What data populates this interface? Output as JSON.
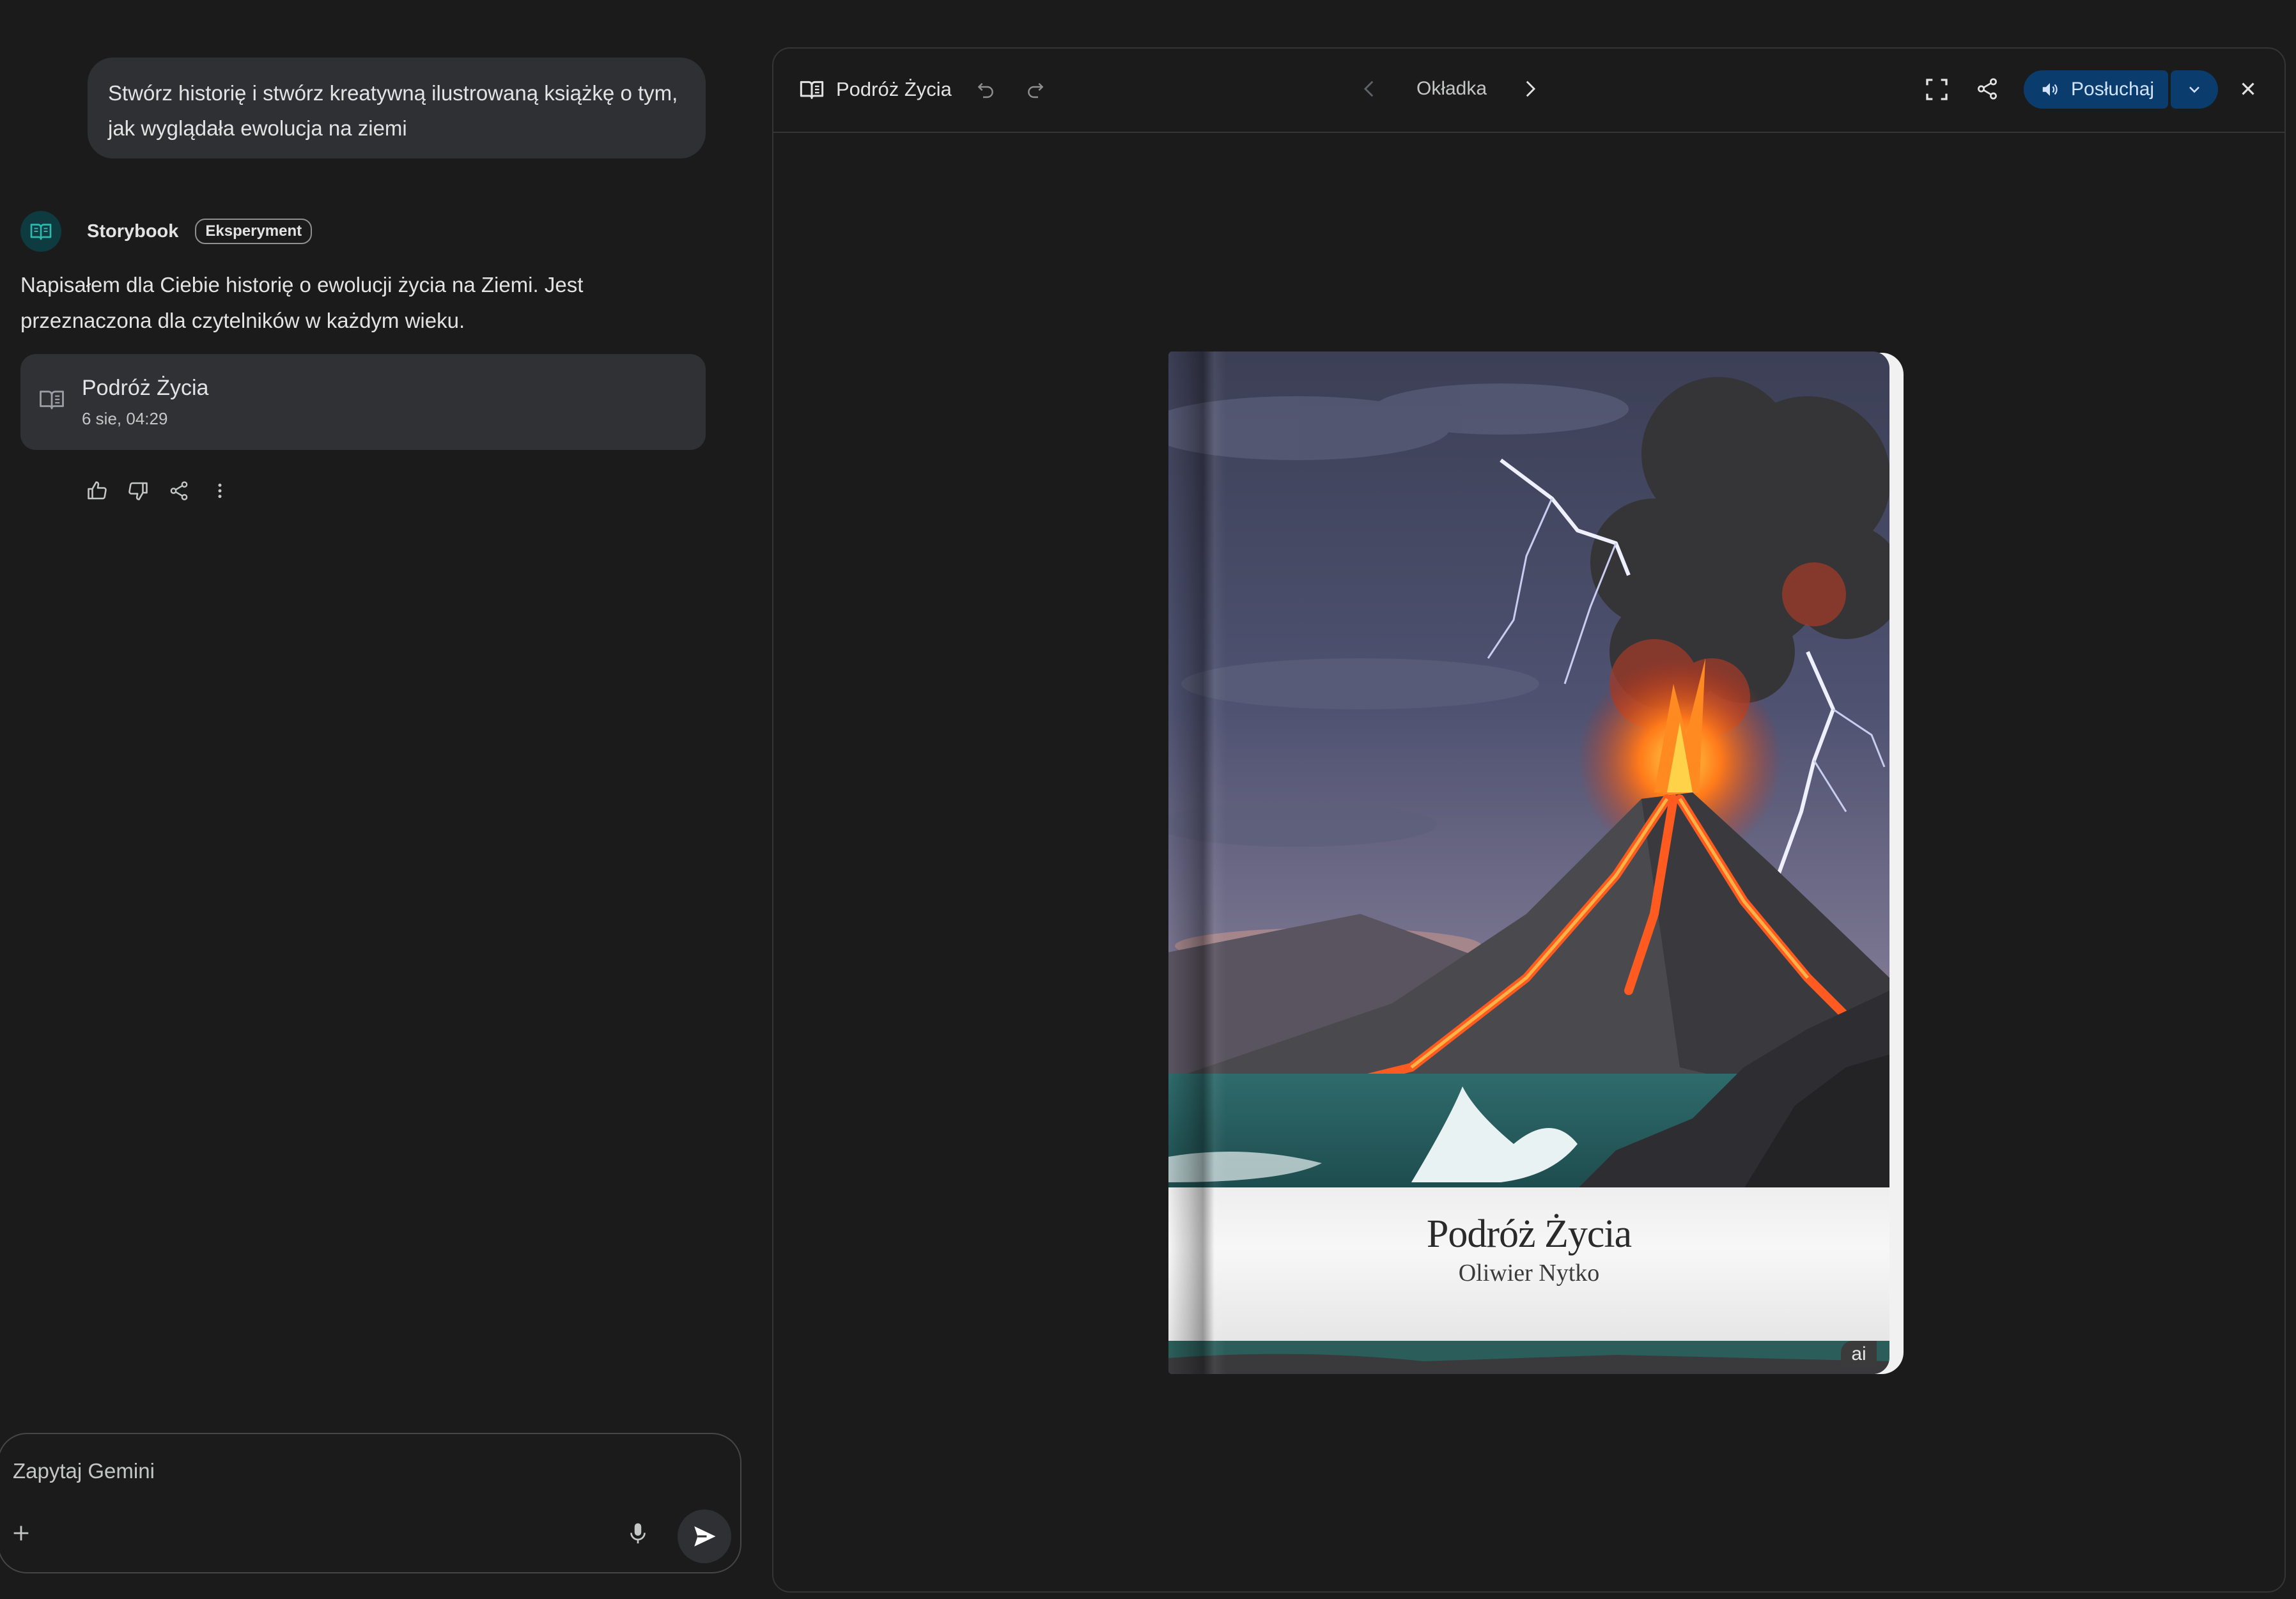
{
  "chat": {
    "user_message": "Stwórz historię i stwórz kreatywną ilustrowaną książkę o tym, jak wyglądała ewolucja na ziemi",
    "agent": {
      "name": "Storybook",
      "badge": "Eksperyment",
      "response": "Napisałem dla Ciebie historię o ewolucji życia na Ziemi. Jest przeznaczona dla czytelników w każdym wieku."
    },
    "story_card": {
      "title": "Podróż Życia",
      "date": "6 sie, 04:29",
      "icon": "book-icon"
    },
    "feedback_icons": [
      "thumb-up-icon",
      "thumb-down-icon",
      "share-icon",
      "more-vert-icon"
    ],
    "input": {
      "placeholder": "Zapytaj Gemini"
    }
  },
  "viewer": {
    "title": "Podróż Życia",
    "page_label": "Okładka",
    "listen_label": "Posłuchaj",
    "accent_color": "#0a3d6e"
  },
  "book": {
    "title": "Podróż Życia",
    "author": "Oliwier Nytko",
    "ai_badge": "ai"
  }
}
